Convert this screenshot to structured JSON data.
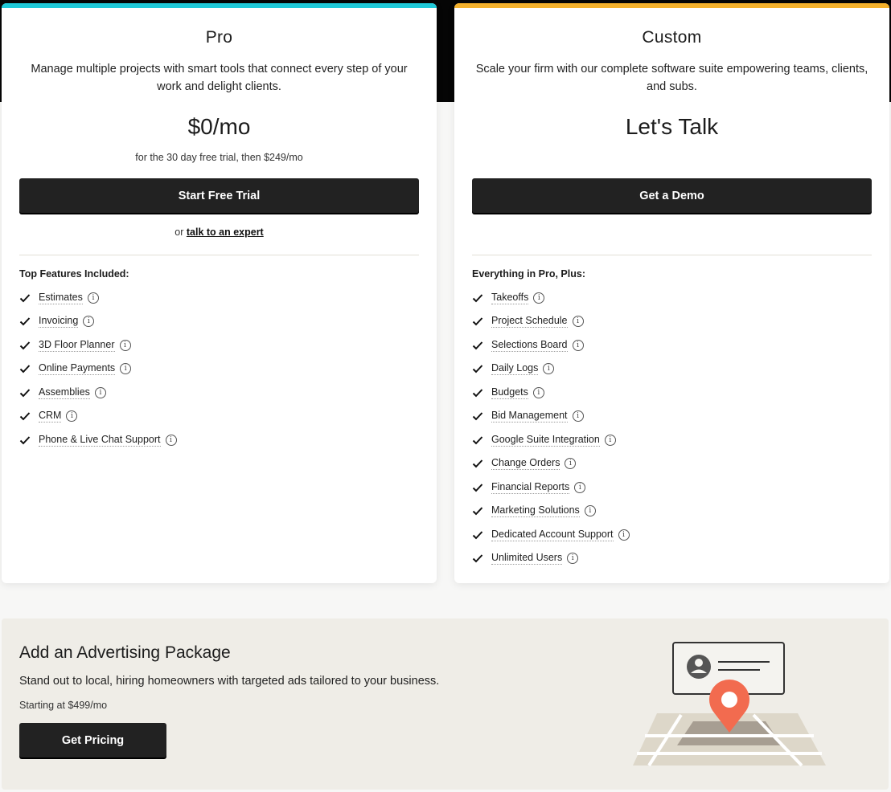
{
  "colors": {
    "pro_accent": "#1fc9d8",
    "custom_accent": "#f4b12c",
    "button": "#222222",
    "pin": "#f26b4f"
  },
  "pro": {
    "name": "Pro",
    "description": "Manage multiple projects with smart tools that connect every step of your work and delight clients.",
    "price": "$0/mo",
    "price_note": "for the 30 day free trial, then $249/mo",
    "cta_label": "Start Free Trial",
    "alt_prefix": "or",
    "alt_link": "talk to an expert",
    "features_title": "Top Features Included:",
    "features": [
      {
        "label": "Estimates"
      },
      {
        "label": "Invoicing"
      },
      {
        "label": "3D Floor Planner"
      },
      {
        "label": "Online Payments"
      },
      {
        "label": "Assemblies"
      },
      {
        "label": "CRM"
      },
      {
        "label": "Phone & Live Chat Support"
      }
    ]
  },
  "custom": {
    "name": "Custom",
    "description": "Scale your firm with our complete software suite empowering teams, clients, and subs.",
    "price": "Let's Talk",
    "cta_label": "Get a Demo",
    "features_title": "Everything in Pro, Plus:",
    "features": [
      {
        "label": "Takeoffs"
      },
      {
        "label": "Project Schedule"
      },
      {
        "label": "Selections Board"
      },
      {
        "label": "Daily Logs"
      },
      {
        "label": "Budgets"
      },
      {
        "label": "Bid Management"
      },
      {
        "label": "Google Suite Integration"
      },
      {
        "label": "Change Orders"
      },
      {
        "label": "Financial Reports"
      },
      {
        "label": "Marketing Solutions"
      },
      {
        "label": "Dedicated Account Support"
      },
      {
        "label": "Unlimited Users"
      }
    ]
  },
  "ad": {
    "title": "Add an Advertising Package",
    "description": "Stand out to local, hiring homeowners with targeted ads tailored to your business.",
    "price": "Starting at $499/mo",
    "cta_label": "Get Pricing"
  },
  "icons": {
    "feature_check": "checkmark-icon",
    "feature_info": "info-icon",
    "illustration": "map-pin-profile-illustration"
  }
}
